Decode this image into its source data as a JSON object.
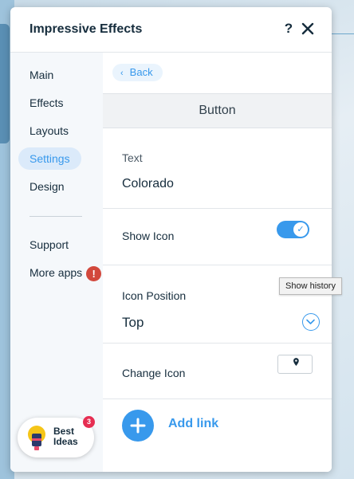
{
  "header": {
    "title": "Impressive Effects",
    "help_label": "?",
    "close_label": "close"
  },
  "sidebar": {
    "items": [
      {
        "label": "Main"
      },
      {
        "label": "Effects"
      },
      {
        "label": "Layouts"
      },
      {
        "label": "Settings",
        "active": true
      },
      {
        "label": "Design"
      },
      {
        "label": "Support"
      },
      {
        "label": "More apps"
      }
    ],
    "more_apps_alert": "!",
    "best_ideas": {
      "label_line1": "Best",
      "label_line2": "Ideas",
      "count": "3"
    }
  },
  "main": {
    "back_label": "Back",
    "section_title": "Button",
    "text_field": {
      "label": "Text",
      "value": "Colorado"
    },
    "show_icon": {
      "label": "Show Icon",
      "enabled": true
    },
    "icon_position": {
      "label": "Icon Position",
      "value": "Top"
    },
    "change_icon": {
      "label": "Change Icon",
      "icon": "location-pin-icon"
    },
    "add_link_label": "Add link"
  },
  "tooltip": {
    "text": "Show history"
  },
  "colors": {
    "accent": "#3899ec",
    "title": "#162d3d",
    "warning": "#d2483c",
    "badge": "#e62e52",
    "sidebar_bg": "#f5f8fb"
  }
}
